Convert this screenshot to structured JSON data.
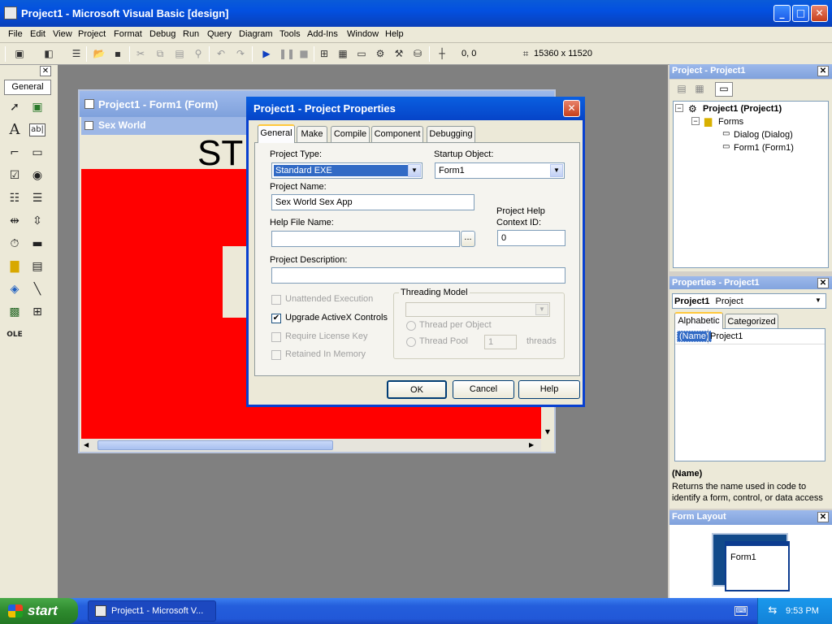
{
  "window": {
    "title": "Project1 - Microsoft Visual Basic [design]"
  },
  "menu": [
    "File",
    "Edit",
    "View",
    "Project",
    "Format",
    "Debug",
    "Run",
    "Query",
    "Diagram",
    "Tools",
    "Add-Ins",
    "Window",
    "Help"
  ],
  "toolbar": {
    "position": "0, 0",
    "size": "15360 x 11520"
  },
  "toolbox": {
    "tab_label": "General"
  },
  "form_window": {
    "title": "Project1 - Form1 (Form)",
    "caption": "Sex World",
    "big_text": "ST"
  },
  "dialog": {
    "title": "Project1 - Project Properties",
    "tabs": [
      "General",
      "Make",
      "Compile",
      "Component",
      "Debugging"
    ],
    "project_type_label": "Project Type:",
    "project_type_value": "Standard EXE",
    "startup_object_label": "Startup Object:",
    "startup_object_value": "Form1",
    "project_name_label": "Project Name:",
    "project_name_value": "Sex World Sex App",
    "help_file_label": "Help File Name:",
    "help_file_value": "",
    "help_browse": "...",
    "help_context_label_1": "Project Help",
    "help_context_label_2": "Context ID:",
    "help_context_value": "0",
    "description_label": "Project Description:",
    "description_value": "",
    "unattended": "Unattended Execution",
    "upgrade_activex": "Upgrade ActiveX Controls",
    "require_license": "Require License Key",
    "retained_memory": "Retained In Memory",
    "threading_model_label": "Threading Model",
    "thread_per_object": "Thread per Object",
    "thread_pool": "Thread Pool",
    "thread_pool_value": "1",
    "threads_label": "threads",
    "ok": "OK",
    "cancel": "Cancel",
    "help": "Help"
  },
  "project_pane": {
    "title": "Project - Project1",
    "root": "Project1 (Project1)",
    "forms_folder": "Forms",
    "items": [
      "Dialog (Dialog)",
      "Form1 (Form1)"
    ]
  },
  "properties_pane": {
    "title": "Properties - Project1",
    "object_name": "Project1",
    "object_type": "Project",
    "tabs": [
      "Alphabetic",
      "Categorized"
    ],
    "prop_name": "(Name)",
    "prop_value": "Project1",
    "desc_title": "(Name)",
    "desc_text": "Returns the name used in code to identify a form, control, or data access"
  },
  "form_layout": {
    "title": "Form Layout",
    "form_label": "Form1"
  },
  "taskbar": {
    "start": "start",
    "task": "Project1 - Microsoft V...",
    "clock": "9:53 PM"
  }
}
